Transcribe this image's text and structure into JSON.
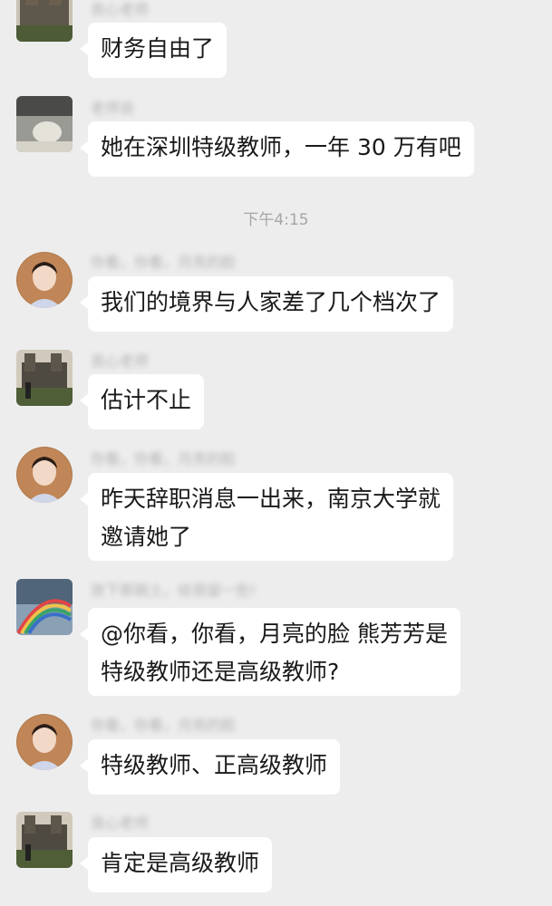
{
  "chat": {
    "timestamp": "下午4:15",
    "messages": [
      {
        "sender": "良心老师",
        "lines": [
          "财务自由了"
        ],
        "avatar": "castle-avatar-icon"
      },
      {
        "sender": "老师说",
        "lines": [
          "她在深圳特级教师，一年 30 万有吧"
        ],
        "avatar": "photo-avatar-icon"
      },
      {
        "sender": "你看，你看，月亮的脸",
        "lines": [
          "我们的境界与人家差了几个档次了"
        ],
        "avatar": "portrait-avatar-icon"
      },
      {
        "sender": "良心老师",
        "lines": [
          "估计不止"
        ],
        "avatar": "castle-avatar-icon"
      },
      {
        "sender": "你看，你看，月亮的脸",
        "lines": [
          "昨天辞职消息一出来，南京大学就",
          "邀请她了"
        ],
        "avatar": "portrait-avatar-icon"
      },
      {
        "sender": "放下那碗土，给我留一些!",
        "lines": [
          "@你看，你看，月亮的脸 熊芳芳是",
          "特级教师还是高级教师?"
        ],
        "avatar": "rainbow-avatar-icon"
      },
      {
        "sender": "你看，你看，月亮的脸",
        "lines": [
          "特级教师、正高级教师"
        ],
        "avatar": "portrait-avatar-icon"
      },
      {
        "sender": "良心老师",
        "lines": [
          "肯定是高级教师"
        ],
        "avatar": "castle-avatar-icon"
      }
    ]
  }
}
